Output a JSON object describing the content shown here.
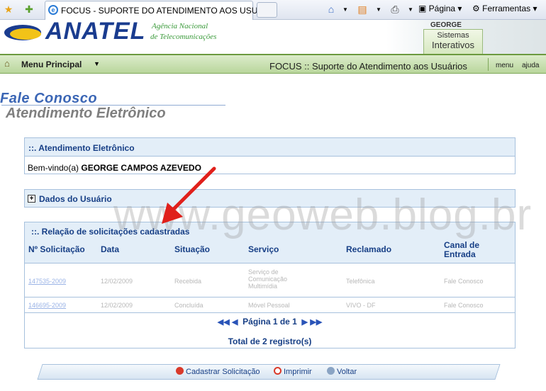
{
  "browser": {
    "tab_title": "FOCUS - SUPORTE DO ATENDIMENTO AOS USU...",
    "page_menu": "Página",
    "tools_menu": "Ferramentas"
  },
  "header": {
    "logo": "ANATEL",
    "agency_line1": "Agência Nacional",
    "agency_line2": "de Telecomunicações",
    "user": "GEORGE",
    "systems_line1": "Sistemas",
    "systems_line2": "Interativos"
  },
  "menu_bar": {
    "main_menu": "Menu Principal",
    "title": "FOCUS :: Suporte do Atendimento aos Usuários",
    "menu_link": "menu",
    "help_link": "ajuda"
  },
  "page": {
    "title": "Fale Conosco",
    "subtitle": "Atendimento Eletrônico"
  },
  "atendimento": {
    "header": "::. Atendimento Eletrônico",
    "welcome_prefix": "Bem-vindo(a) ",
    "welcome_name": "GEORGE CAMPOS AZEVEDO"
  },
  "user_data": {
    "header": "Dados do Usuário"
  },
  "requests": {
    "header": "::.   Relação de solicitações cadastradas",
    "columns": [
      "Nº Solicitação",
      "Data",
      "Situação",
      "Serviço",
      "Reclamado",
      "Canal de Entrada"
    ],
    "rows": [
      [
        "147535-2009",
        "12/02/2009",
        "Recebida",
        "Serviço de Comunicação Multimídia",
        "Telefônica",
        "Fale Conosco"
      ],
      [
        "146695-2009",
        "12/02/2009",
        "Concluída",
        "Móvel Pessoal",
        "VIVO - DF",
        "Fale Conosco"
      ]
    ],
    "pager": "Página 1 de 1",
    "total": "Total de 2 registro(s)"
  },
  "actions": {
    "register": "Cadastrar Solicitação",
    "print": "Imprimir",
    "back": "Voltar"
  },
  "watermark": "www.geoweb.blog.br"
}
